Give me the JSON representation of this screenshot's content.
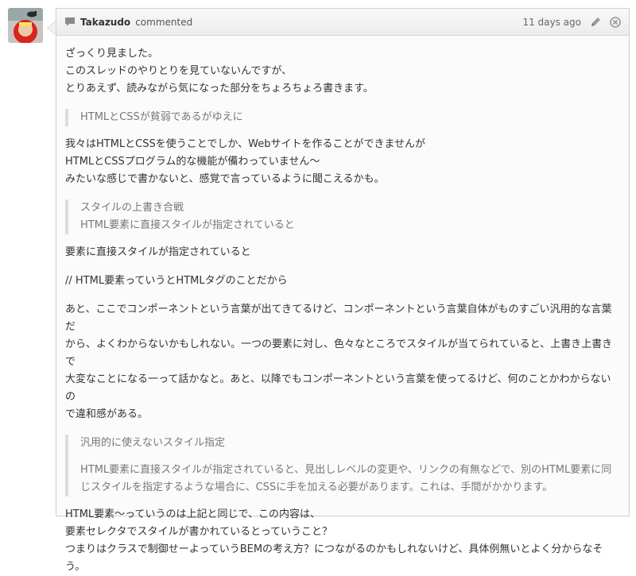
{
  "comment": {
    "author": "Takazudo",
    "action": "commented",
    "timestamp": "11 days ago",
    "icons": {
      "speech": "speech-bubble-icon",
      "edit": "pencil-edit-icon",
      "close": "close-circle-icon"
    }
  },
  "body": {
    "p1": [
      "ざっくり見ました。",
      "このスレッドのやりとりを見ていないんですが、",
      "とりあえず、読みながら気になった部分をちょろちょろ書きます。"
    ],
    "quote1": "HTMLとCSSが貧弱であるがゆえに",
    "p2": [
      "我々はHTMLとCSSを使うことでしか、Webサイトを作ることができませんが",
      "HTMLとCSSプログラム的な機能が備わっていません〜",
      "みたいな感じで書かないと、感覚で言っているように聞こえるかも。"
    ],
    "quote2": [
      "スタイルの上書き合戦",
      "HTML要素に直接スタイルが指定されていると"
    ],
    "p3": "要素に直接スタイルが指定されていると",
    "p4": "// HTML要素っていうとHTMLタグのことだから",
    "p5": [
      "あと、ここでコンポーネントという言葉が出てきてるけど、コンポーネントという言葉自体がものすごい汎用的な言葉だ",
      "から、よくわからないかもしれない。一つの要素に対し、色々なところでスタイルが当てられていると、上書き上書きで",
      "大変なことになる一って話かなと。あと、以降でもコンポーネントという言葉を使ってるけど、何のことかわからないの",
      "で違和感がある。"
    ],
    "quote3_title": "汎用的に使えないスタイル指定",
    "quote3_body": [
      "HTML要素に直接スタイルが指定されていると、見出しレベルの変更や、リンクの有無などで、別のHTML要素に同",
      "じスタイルを指定するような場合に、CSSに手を加える必要があります。これは、手間がかかります。"
    ],
    "p6": [
      "HTML要素〜っていうのは上記と同じで、この内容は、",
      "要素セレクタでスタイルが書かれているとっていうこと？",
      "つまりはクラスで制御せーよっていうBEMの考え方？につながるのかもしれないけど、具体例無いとよく分からなそう。"
    ]
  },
  "colors": {
    "border": "#cfcfcf",
    "header_bg": "#ececec",
    "quote_border": "#dddddd",
    "quote_text": "#777777"
  }
}
